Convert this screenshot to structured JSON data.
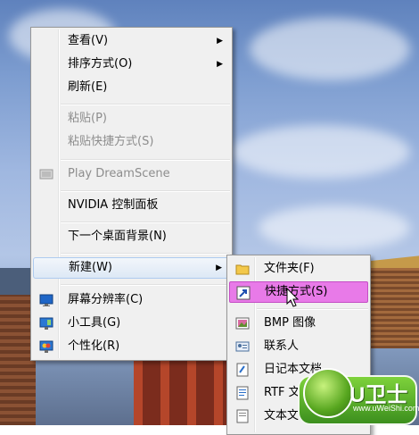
{
  "context_menu": {
    "items": [
      {
        "label": "查看(V)",
        "has_submenu": true,
        "enabled": true
      },
      {
        "label": "排序方式(O)",
        "has_submenu": true,
        "enabled": true
      },
      {
        "label": "刷新(E)",
        "enabled": true
      },
      {
        "label": "粘贴(P)",
        "enabled": false
      },
      {
        "label": "粘贴快捷方式(S)",
        "enabled": false
      },
      {
        "label": "Play DreamScene",
        "enabled": false,
        "icon": "dreamscene-icon"
      },
      {
        "label": "NVIDIA 控制面板",
        "enabled": true
      },
      {
        "label": "下一个桌面背景(N)",
        "enabled": true
      },
      {
        "label": "新建(W)",
        "has_submenu": true,
        "enabled": true,
        "state": "hover"
      },
      {
        "label": "屏幕分辨率(C)",
        "enabled": true,
        "icon": "monitor-icon"
      },
      {
        "label": "小工具(G)",
        "enabled": true,
        "icon": "gadgets-icon"
      },
      {
        "label": "个性化(R)",
        "enabled": true,
        "icon": "personalize-icon"
      }
    ]
  },
  "new_submenu": {
    "items": [
      {
        "label": "文件夹(F)",
        "icon": "folder-icon"
      },
      {
        "label": "快捷方式(S)",
        "icon": "shortcut-icon",
        "state": "selected"
      },
      {
        "label": "BMP 图像",
        "icon": "bmp-image-icon"
      },
      {
        "label": "联系人",
        "icon": "contact-icon"
      },
      {
        "label": "日记本文档",
        "icon": "journal-icon"
      },
      {
        "label": "RTF 文档",
        "icon": "rtf-document-icon"
      },
      {
        "label": "文本文档",
        "icon": "text-document-icon"
      }
    ]
  },
  "watermark": {
    "brand": "U卫士",
    "url": "www.uWeiShi.com"
  },
  "colors": {
    "menu_bg": "#f0f0f0",
    "selected_bg": "#e87ae8",
    "hover_border": "#aecbef",
    "disabled_text": "#8d8d8d"
  }
}
